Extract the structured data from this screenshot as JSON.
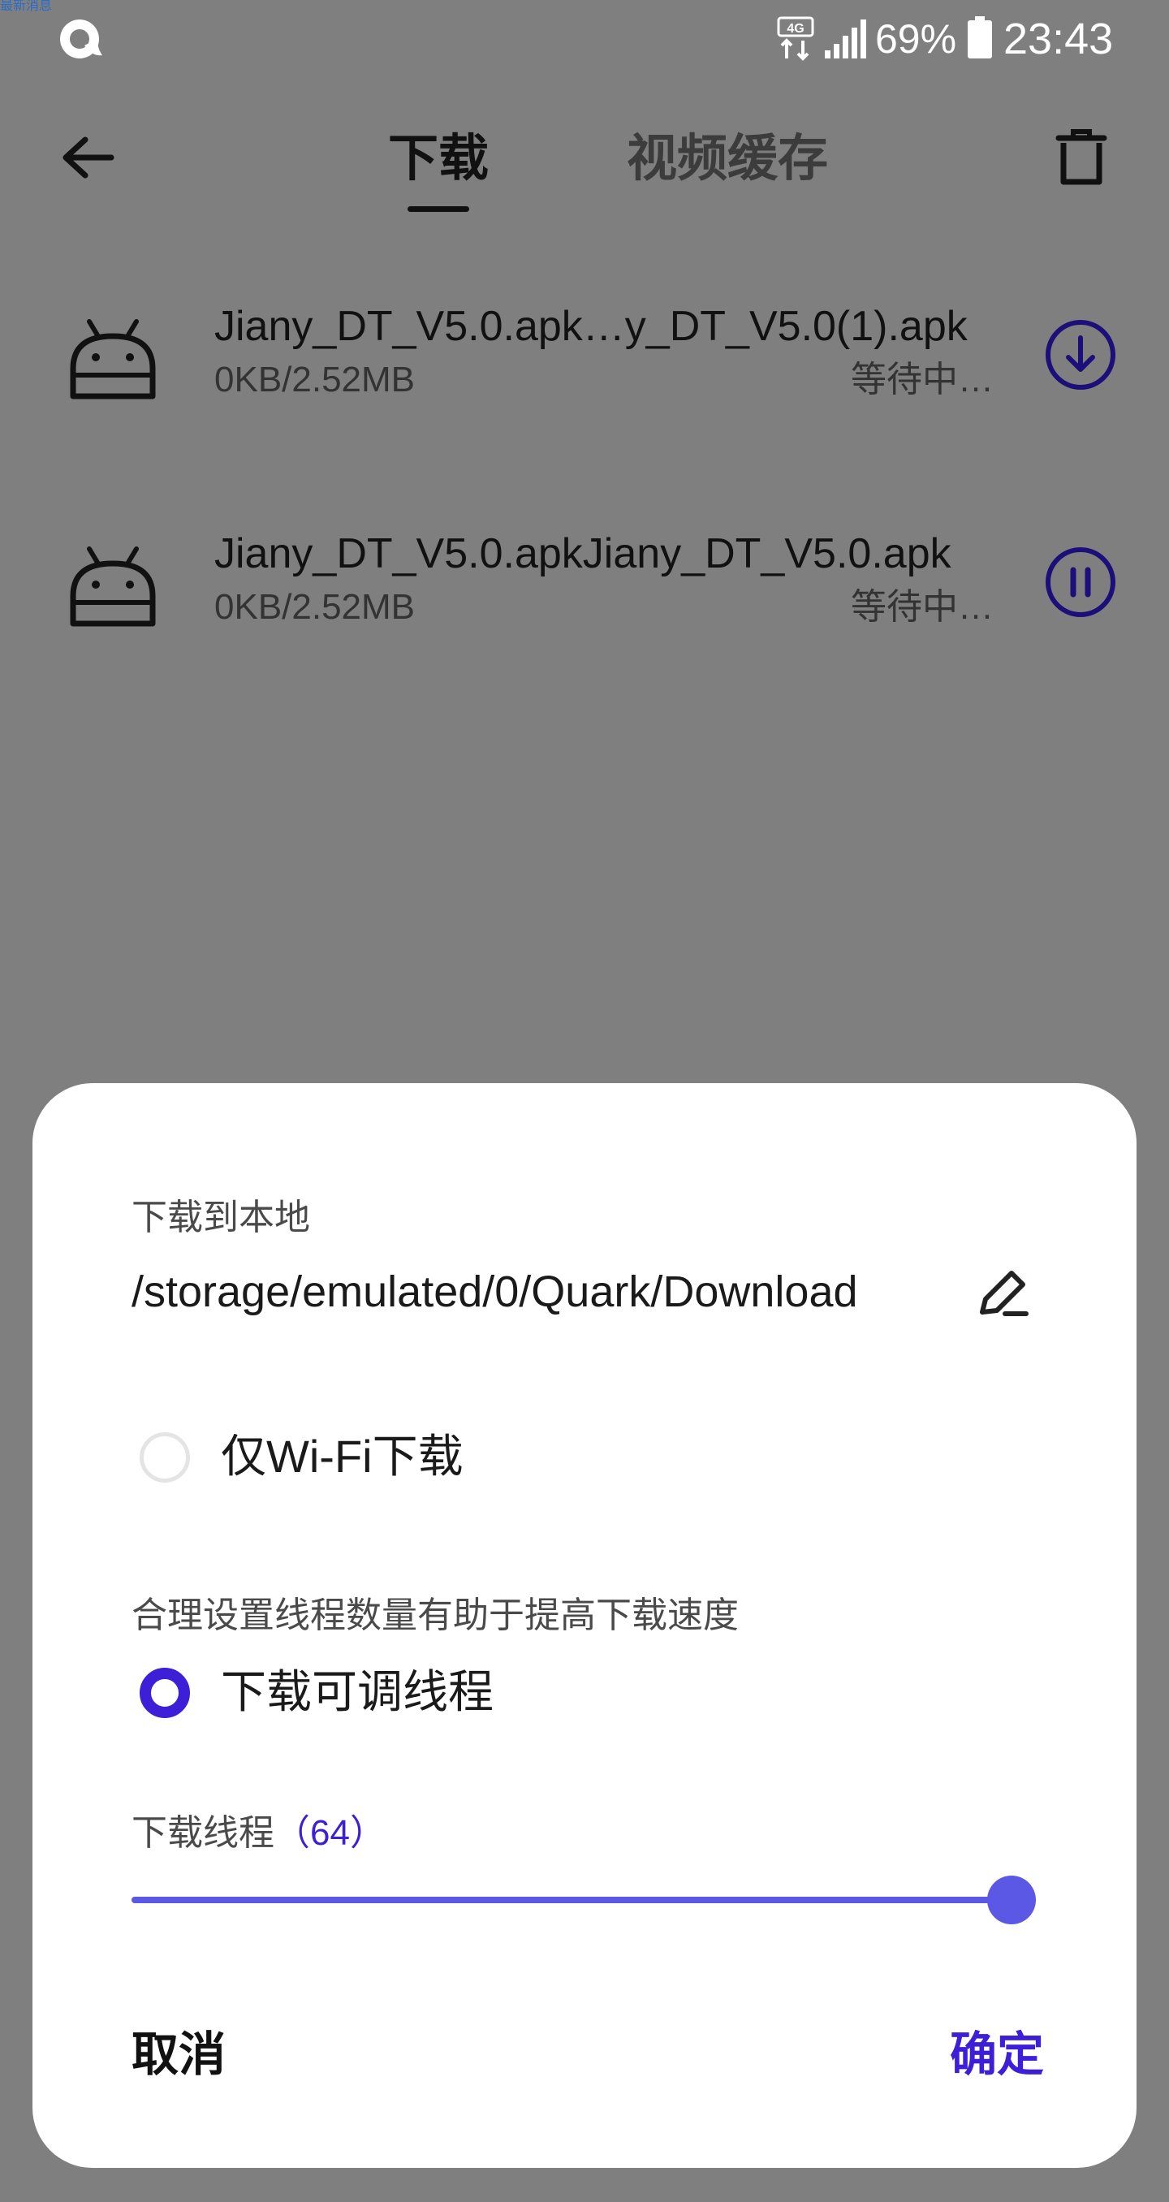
{
  "status_bar": {
    "tiny_label": "最新消息",
    "network": "4G",
    "battery": "69%",
    "time": "23:43"
  },
  "nav": {
    "tabs": [
      {
        "label": "下载",
        "active": true
      },
      {
        "label": "视频缓存",
        "active": false
      }
    ]
  },
  "downloads": [
    {
      "name": "Jiany_DT_V5.0.apk…y_DT_V5.0(1).apk",
      "size": "0KB/2.52MB",
      "status": "等待中…",
      "action": "download-icon"
    },
    {
      "name": "Jiany_DT_V5.0.apkJiany_DT_V5.0.apk",
      "size": "0KB/2.52MB",
      "status": "等待中…",
      "action": "pause-icon"
    }
  ],
  "dialog": {
    "local_label": "下载到本地",
    "path": "/storage/emulated/0/Quark/Download",
    "wifi_only": {
      "label": "仅Wi-Fi下载",
      "checked": false
    },
    "thread_hint": "合理设置线程数量有助于提高下载速度",
    "adjustable_threads": {
      "label": "下载可调线程",
      "checked": true
    },
    "thread_count": {
      "label": "下载线程",
      "value": "（64）",
      "fraction": 1.0
    },
    "cancel_label": "取消",
    "confirm_label": "确定"
  },
  "colors": {
    "accent": "#3c1fd7",
    "slider": "#5b58e6",
    "dim_overlay": "#7f7f7f"
  }
}
